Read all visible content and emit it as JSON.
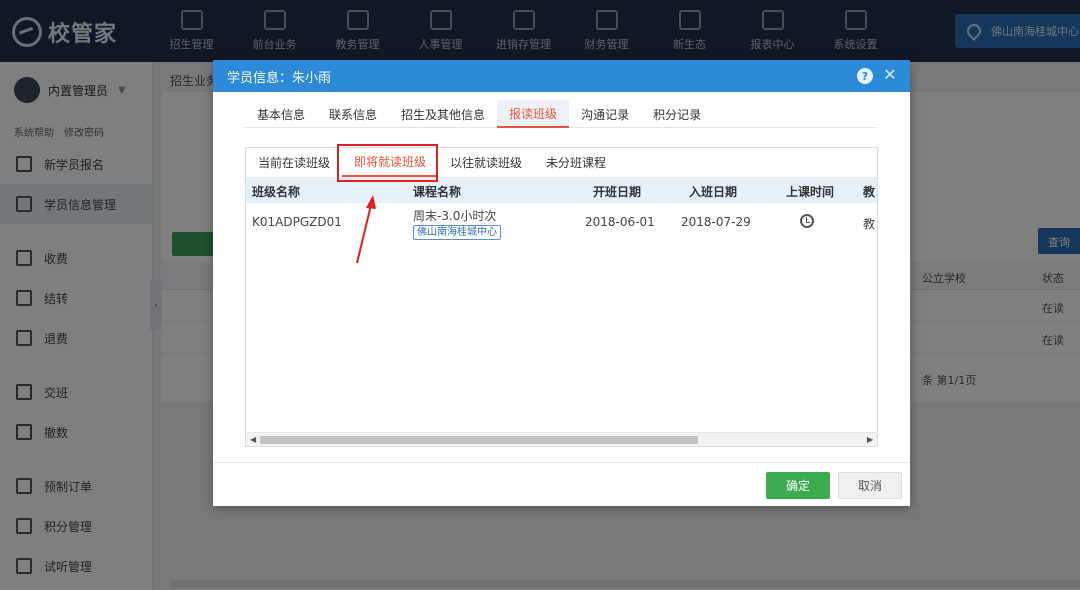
{
  "app": {
    "logo_text": "校管家",
    "nav": [
      "招生管理",
      "前台业务",
      "教务管理",
      "人事管理",
      "进销存管理",
      "财务管理",
      "新生态",
      "报表中心",
      "系统设置"
    ],
    "campus": "佛山南海桂城中心"
  },
  "sidebar": {
    "user": "内置管理员",
    "links": [
      "系统帮助",
      "修改密码"
    ],
    "items": [
      "新学员报名",
      "学员信息管理",
      "收费",
      "结转",
      "退费",
      "交班",
      "撤数",
      "预制订单",
      "积分管理",
      "试听管理"
    ]
  },
  "background": {
    "crumb": "招生业务",
    "header_cols": [
      "公立学校",
      "状态"
    ],
    "row_status": [
      "在读",
      "在读"
    ],
    "pager": "条 第1/1页",
    "btn_label": "查询"
  },
  "modal": {
    "title": "学员信息：朱小雨",
    "help": "?",
    "close": "✕",
    "tabs": [
      "基本信息",
      "联系信息",
      "招生及其他信息",
      "报读班级",
      "沟通记录",
      "积分记录"
    ],
    "active_tab": "报读班级",
    "subtabs": [
      "当前在读班级",
      "即将就读班级",
      "以往就读班级",
      "未分班课程"
    ],
    "active_subtab": "即将就读班级",
    "table": {
      "columns": [
        "班级名称",
        "课程名称",
        "开班日期",
        "入班日期",
        "上课时间",
        "教"
      ],
      "rows": [
        {
          "class_name": "K01ADPGZD01",
          "course_name": "周末-3.0小时次",
          "campus_tag": "佛山南海桂城中心",
          "start_date": "2018-06-01",
          "join_date": "2018-07-29",
          "time_icon": "alarm-clock-icon",
          "teacher": "教"
        }
      ]
    },
    "footer": {
      "ok": "确定",
      "cancel": "取消"
    }
  },
  "colors": {
    "header_blue": "#2d8ad8",
    "active_red": "#e4553b",
    "ok_green": "#3bab4f",
    "annotation_red": "#e02020"
  }
}
